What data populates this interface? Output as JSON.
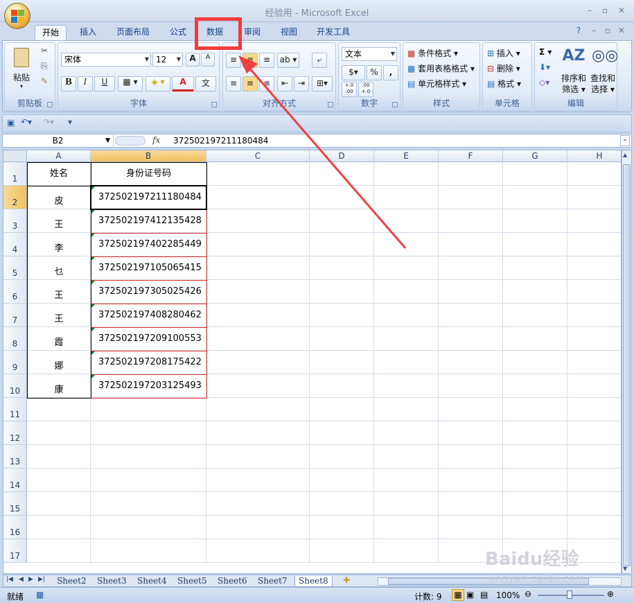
{
  "window": {
    "title": "经验用 - Microsoft Excel"
  },
  "tabs": [
    "开始",
    "插入",
    "页面布局",
    "公式",
    "数据",
    "审阅",
    "视图",
    "开发工具"
  ],
  "ribbon": {
    "clipboard": {
      "label": "剪贴板",
      "paste": "粘贴"
    },
    "font": {
      "label": "字体",
      "name": "宋体",
      "size": "12",
      "bold": "B",
      "italic": "I",
      "underline": "U",
      "grow": "A",
      "shrink": "A",
      "font_color": "A",
      "phonetic": "文"
    },
    "alignment": {
      "label": "对齐方式"
    },
    "number": {
      "label": "数字",
      "format": "文本",
      "percent": "%",
      "comma": ",",
      "inc": "+.0 .00",
      "dec": ".00 +.0"
    },
    "styles": {
      "label": "样式",
      "cond_format": "条件格式",
      "table_format": "套用表格格式",
      "cell_styles": "单元格样式"
    },
    "cells": {
      "label": "单元格",
      "insert": "插入",
      "delete": "删除",
      "format": "格式"
    },
    "editing": {
      "label": "编辑",
      "sigma": "Σ",
      "sort_filter_l1": "排序和",
      "sort_filter_l2": "筛选",
      "find_l1": "查找和",
      "find_l2": "选择"
    }
  },
  "formula_bar": {
    "name_box": "B2",
    "fx": "fx",
    "value": "372502197211180484"
  },
  "columns": [
    "A",
    "B",
    "C",
    "D",
    "E",
    "F",
    "G",
    "H"
  ],
  "rows": [
    "1",
    "2",
    "3",
    "4",
    "5",
    "6",
    "7",
    "8",
    "9",
    "10",
    "11",
    "12",
    "13",
    "14",
    "15",
    "16",
    "17"
  ],
  "table": {
    "headers": [
      "姓名",
      "身份证号码"
    ],
    "rows": [
      [
        "皮",
        "372502197211180484"
      ],
      [
        "王",
        "372502197412135428"
      ],
      [
        "李",
        "372502197402285449"
      ],
      [
        "乜",
        "372502197105065415"
      ],
      [
        "王",
        "372502197305025426"
      ],
      [
        "王",
        "372502197408280462"
      ],
      [
        "霞",
        "372502197209100553"
      ],
      [
        "娜",
        "372502197208175422"
      ],
      [
        "康",
        "372502197203125493"
      ]
    ]
  },
  "sheets": [
    "Sheet2",
    "Sheet3",
    "Sheet4",
    "Sheet5",
    "Sheet6",
    "Sheet7",
    "Sheet8"
  ],
  "active_sheet": "Sheet8",
  "status": {
    "ready": "就绪",
    "count": "计数: 9",
    "zoom": "100%"
  },
  "watermark": {
    "brand": "Baidu经验",
    "url": "jingyan.baidu.com"
  },
  "colors": {
    "highlight": "#f23b3b",
    "accent": "#15428b",
    "number_border": "#e0302c"
  }
}
